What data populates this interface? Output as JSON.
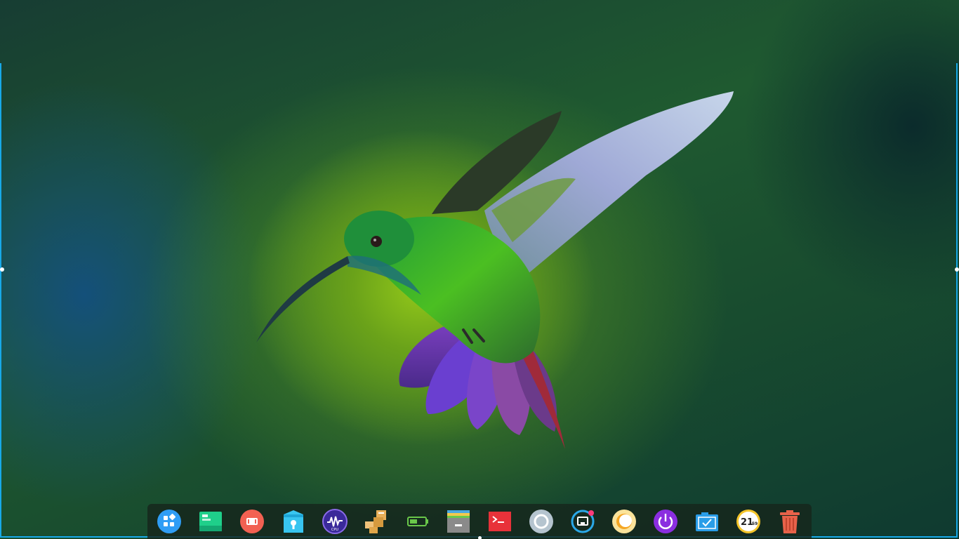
{
  "desktop": {
    "wallpaper": "hummingbird",
    "accent_color": "#17a9e8"
  },
  "dock": {
    "items": [
      {
        "name": "launcher",
        "icon": "launcher-icon"
      },
      {
        "name": "multitasking-view",
        "icon": "multitasking-view-icon"
      },
      {
        "name": "screen-recorder",
        "icon": "screen-recorder-icon"
      },
      {
        "name": "file-vault",
        "icon": "file-vault-icon"
      },
      {
        "name": "system-monitor",
        "icon": "system-monitor-icon",
        "label": "CPU"
      },
      {
        "name": "package-manager",
        "icon": "package-manager-icon"
      },
      {
        "name": "battery",
        "icon": "battery-icon"
      },
      {
        "name": "file-manager",
        "icon": "file-manager-icon"
      },
      {
        "name": "terminal",
        "icon": "terminal-icon"
      },
      {
        "name": "control-center",
        "icon": "control-center-icon"
      },
      {
        "name": "network",
        "icon": "network-icon"
      },
      {
        "name": "night-mode",
        "icon": "night-mode-icon"
      },
      {
        "name": "power",
        "icon": "power-icon"
      },
      {
        "name": "screenshot",
        "icon": "screenshot-icon"
      },
      {
        "name": "clock",
        "icon": "clock-icon",
        "hour": "21",
        "minute": "59"
      },
      {
        "name": "trash",
        "icon": "trash-icon"
      }
    ]
  }
}
